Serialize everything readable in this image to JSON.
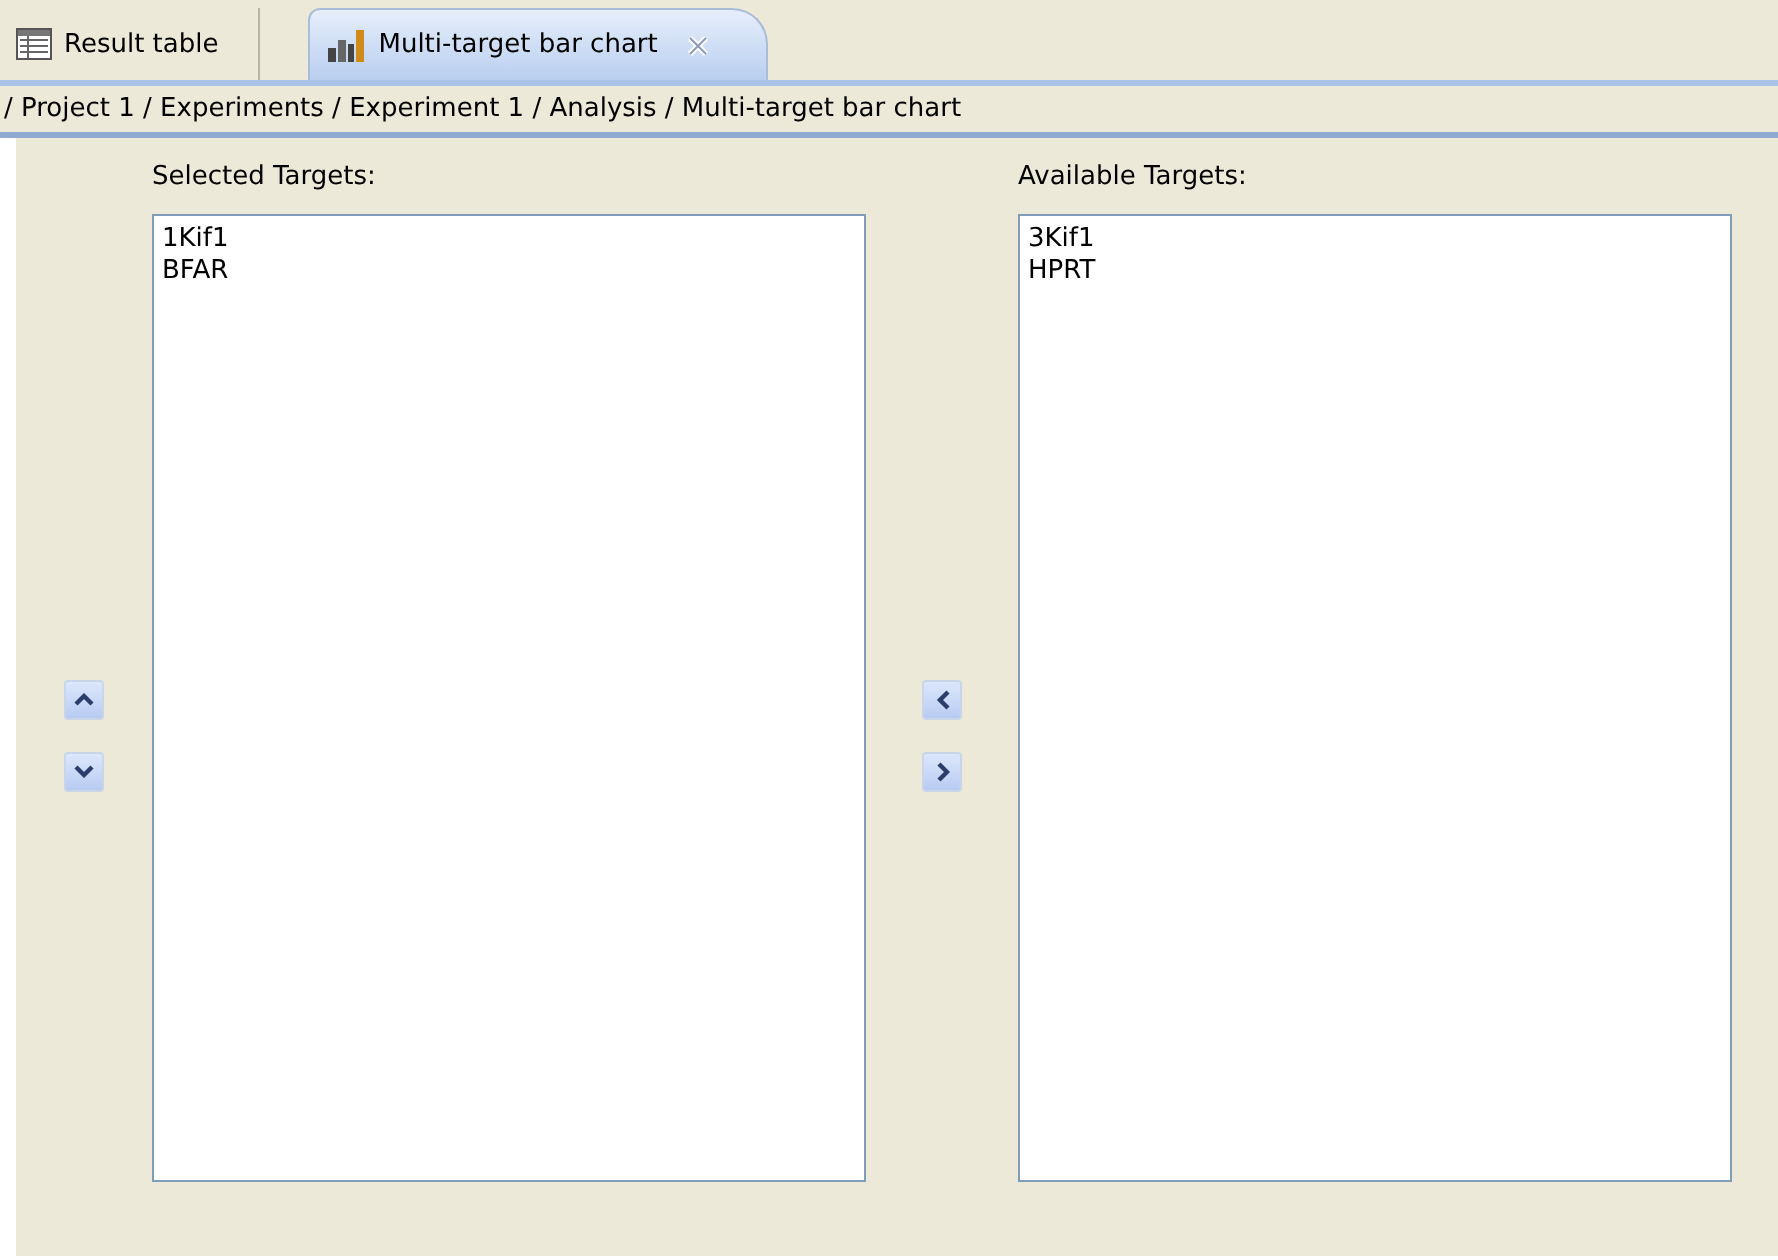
{
  "tabs": [
    {
      "label": "Result table",
      "kind": "table",
      "selected": false,
      "closable": false
    },
    {
      "label": "Multi-target bar chart",
      "kind": "chart",
      "selected": true,
      "closable": true
    }
  ],
  "breadcrumb": "/ Project 1 / Experiments / Experiment 1 / Analysis / Multi-target bar chart",
  "selected_targets": {
    "label": "Selected Targets:",
    "items": [
      "1Kif1",
      "BFAR"
    ]
  },
  "available_targets": {
    "label": "Available Targets:",
    "items": [
      "3Kif1",
      "HPRT"
    ]
  }
}
